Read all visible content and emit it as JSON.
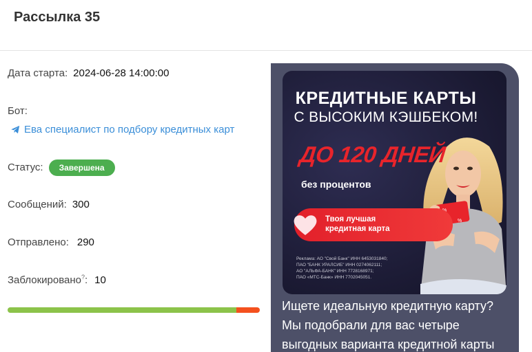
{
  "header": {
    "title": "Рассылка 35"
  },
  "info": {
    "start_label": "Дата старта:",
    "start_value": "2024-06-28 14:00:00",
    "bot_label": "Бот:",
    "bot_name": "Ева специалист по подбору кредитных карт",
    "status_label": "Статус:",
    "status_value": "Завершена",
    "messages_label": "Сообщений:",
    "messages_value": "300",
    "sent_label": "Отправлено:",
    "sent_value": "290",
    "blocked_label": "Заблокировано",
    "blocked_hint": "?",
    "blocked_suffix": ":",
    "blocked_value": "10"
  },
  "progress": {
    "sent_fraction": 0.9067,
    "blocked_fraction": 0.0933,
    "sent_color": "#8cc34a",
    "blocked_color": "#f4511e"
  },
  "preview": {
    "banner_title": "КРЕДИТНЫЕ КАРТЫ",
    "banner_subtitle": "С ВЫСОКИМ КЭШБЕКОМ!",
    "banner_days": "ДО 120 ДНЕЙ",
    "banner_no_interest": "без процентов",
    "pill_line1": "Твоя лучшая",
    "pill_line2": "кредитная карта",
    "legal_1": "Реклама: АО \"Свой Банк\" ИНН 6453031840;",
    "legal_2": "ПАО \"БАНК УРАЛСИБ\" ИНН 0274062111;",
    "legal_3": "АО \"АЛЬФА-БАНК\" ИНН 7728168971;",
    "legal_4": "ПАО «МТС-Банк» ИНН 7702045051.",
    "caption_line1": "Ищете идеальную кредитную карту?",
    "caption_line2": "Мы подобрали для вас четыре",
    "caption_line3": "выгодных варианта кредитной карты"
  },
  "colors": {
    "status_badge": "#4cae4f",
    "link": "#3a8ed8",
    "preview_bg": "#4d5068",
    "banner_accent": "#e8242b"
  },
  "icons": {
    "bot": "telegram-plane-icon",
    "pill": "heart-icon"
  }
}
